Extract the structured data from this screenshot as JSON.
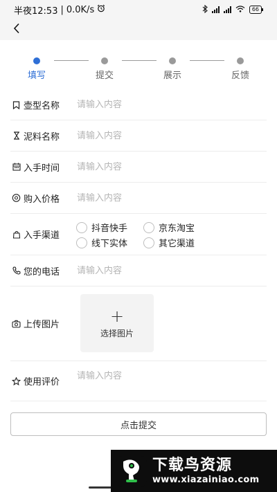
{
  "status_bar": {
    "time": "半夜12:53",
    "network_speed": "0.0K/s",
    "alarm_icon": "alarm-clock-icon",
    "battery": "66"
  },
  "nav": {
    "back_icon": "chevron-left-icon"
  },
  "steps": [
    {
      "label": "填写",
      "active": true
    },
    {
      "label": "提交",
      "active": false
    },
    {
      "label": "展示",
      "active": false
    },
    {
      "label": "反馈",
      "active": false
    }
  ],
  "form": {
    "fields": [
      {
        "label": "壶型名称",
        "placeholder": "请输入内容",
        "icon": "bookmark-icon"
      },
      {
        "label": "泥料名称",
        "placeholder": "请输入内容",
        "icon": "hourglass-icon"
      },
      {
        "label": "入手时间",
        "placeholder": "请输入内容",
        "icon": "calendar-icon"
      },
      {
        "label": "购入价格",
        "placeholder": "请输入内容",
        "icon": "eye-icon"
      }
    ],
    "channel": {
      "label": "入手渠道",
      "icon": "shopping-bag-icon",
      "options": [
        "抖音快手",
        "京东淘宝",
        "线下实体",
        "其它渠道"
      ]
    },
    "phone": {
      "label": "您的电话",
      "placeholder": "请输入内容",
      "icon": "phone-icon"
    },
    "upload": {
      "label": "上传图片",
      "button_text": "选择图片",
      "icon": "camera-icon"
    },
    "review": {
      "label": "使用评价",
      "placeholder": "请输入内容",
      "icon": "star-icon"
    }
  },
  "submit_label": "点击提交",
  "watermark": {
    "title": "下载鸟资源",
    "url": "www.xiazainiao.com"
  },
  "colors": {
    "accent": "#2f6fd6",
    "inactive": "#9a9a9a",
    "placeholder": "#b5b5b5",
    "bar_bg": "#f5f5f5"
  }
}
